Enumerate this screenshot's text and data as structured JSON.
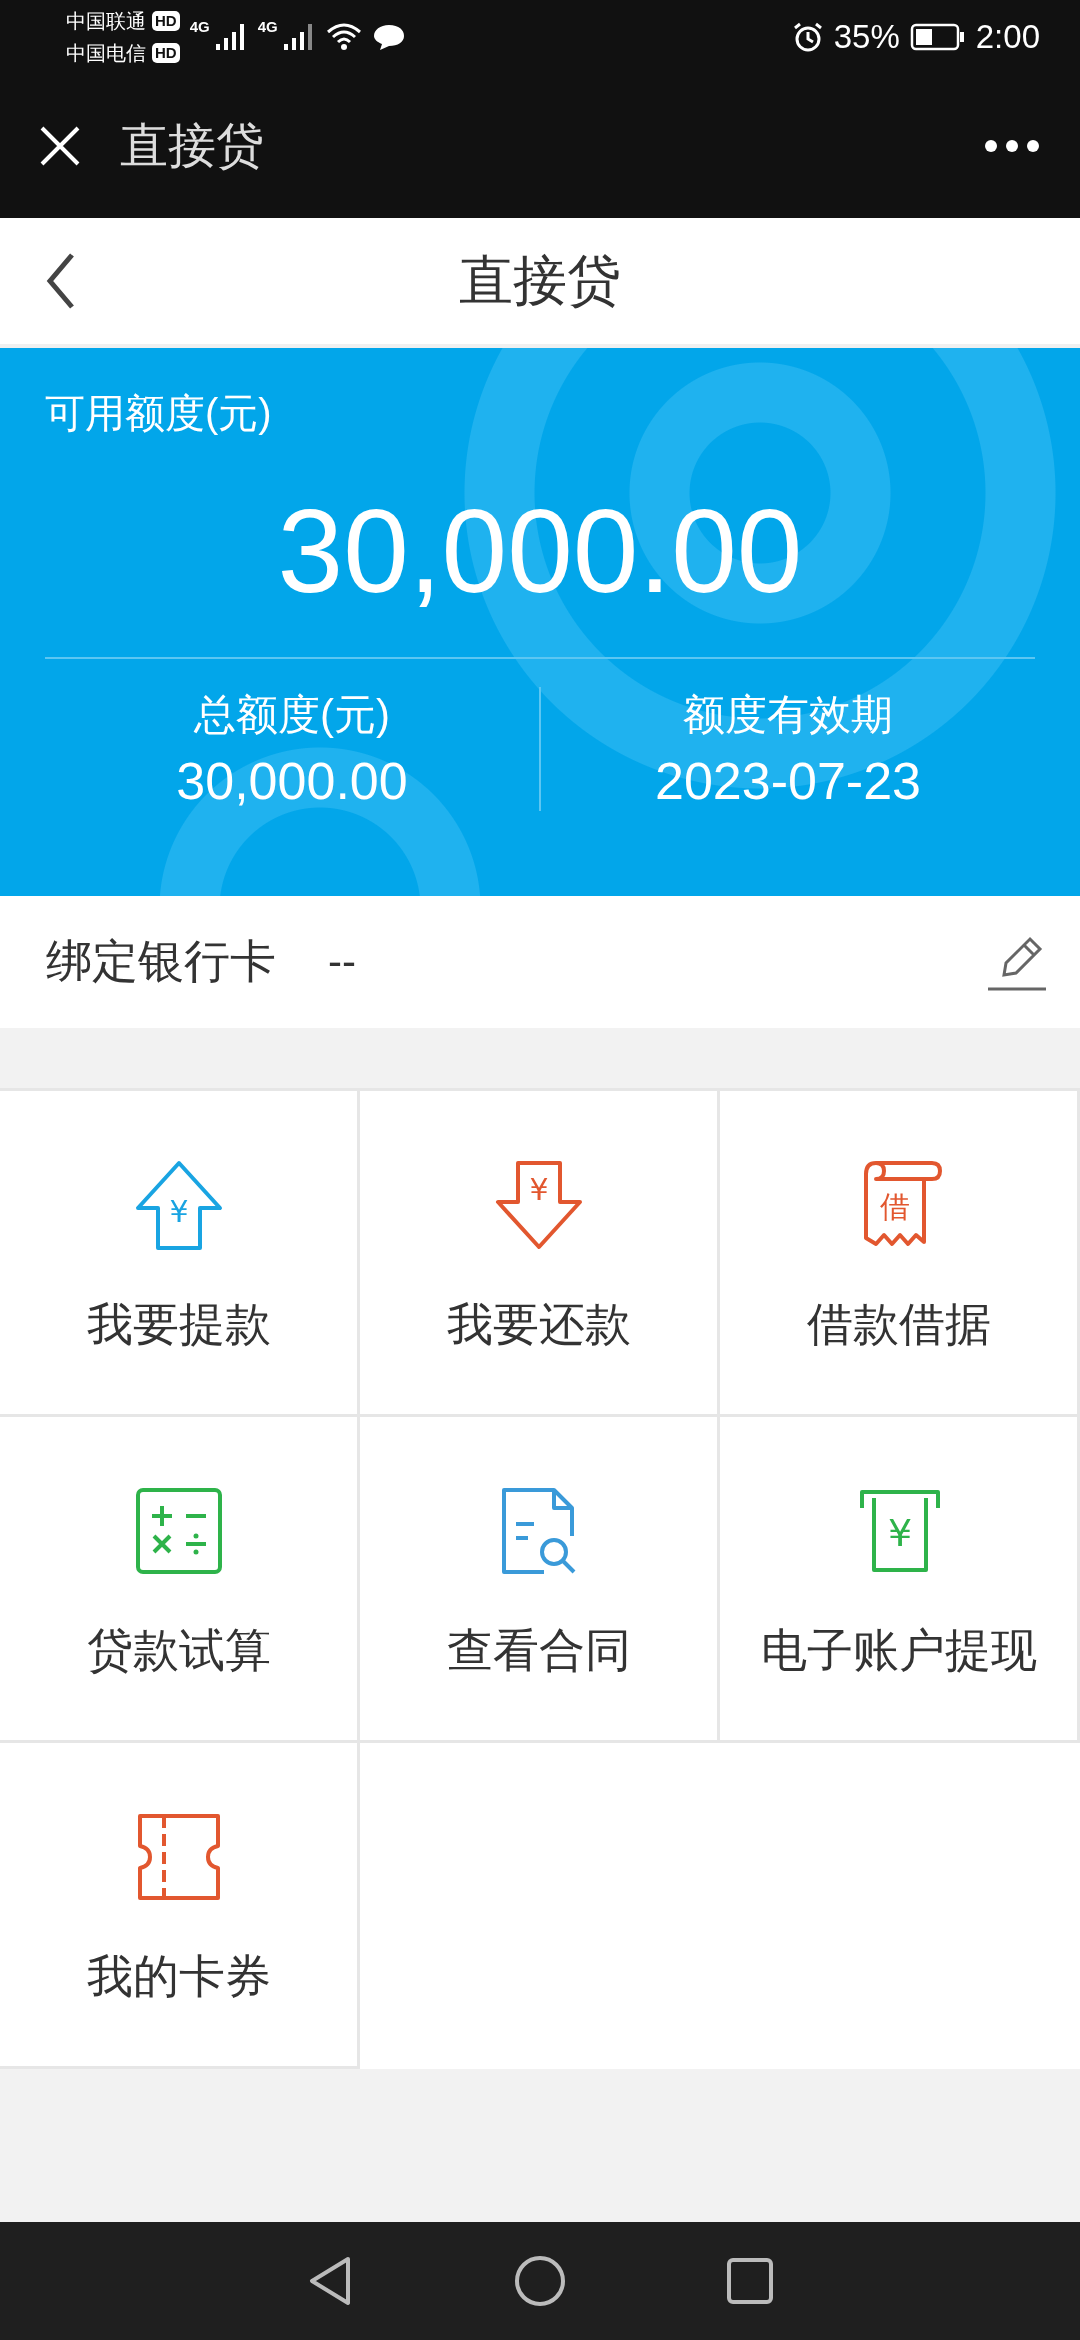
{
  "status_bar": {
    "carrier_1": "中国联通",
    "badge_1": "HD",
    "carrier_2": "中国电信",
    "badge_2": "HD",
    "network_1": "4G",
    "network_2": "4G",
    "battery": "35%",
    "time": "2:00"
  },
  "app_bar": {
    "title": "直接贷"
  },
  "page_header": {
    "title": "直接贷"
  },
  "credit_card": {
    "available_label": "可用额度(元)",
    "available_amount": "30,000.00",
    "stats": [
      {
        "label": "总额度(元)",
        "value": "30,000.00"
      },
      {
        "label": "额度有效期",
        "value": "2023-07-23"
      }
    ]
  },
  "bank_card": {
    "label": "绑定银行卡",
    "value": "--"
  },
  "services": [
    {
      "label": "我要提款",
      "icon_text": "¥"
    },
    {
      "label": "我要还款",
      "icon_text": "¥"
    },
    {
      "label": "借款借据",
      "icon_text": "借"
    },
    {
      "label": "贷款试算"
    },
    {
      "label": "查看合同"
    },
    {
      "label": "电子账户提现",
      "icon_text": "¥"
    },
    {
      "label": "我的卡券"
    }
  ]
}
